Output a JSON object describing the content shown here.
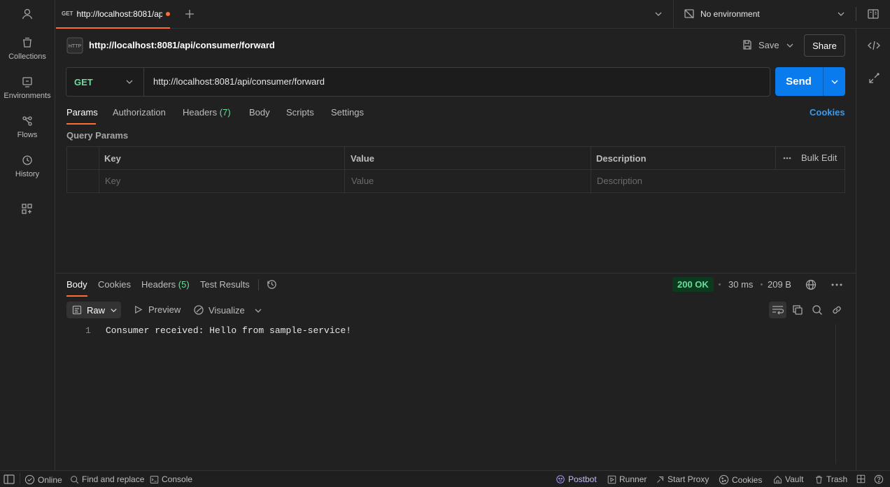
{
  "sidebar": {
    "items": [
      {
        "label": "Collections"
      },
      {
        "label": "Environments"
      },
      {
        "label": "Flows"
      },
      {
        "label": "History"
      }
    ]
  },
  "tab": {
    "method": "GET",
    "title": "http://localhost:8081/ap"
  },
  "environment": {
    "label": "No environment"
  },
  "request": {
    "name": "http://localhost:8081/api/consumer/forward",
    "save_label": "Save",
    "share_label": "Share",
    "method": "GET",
    "url": "http://localhost:8081/api/consumer/forward",
    "send_label": "Send",
    "tabs": [
      {
        "label": "Params"
      },
      {
        "label": "Authorization"
      },
      {
        "label": "Headers",
        "count": "(7)"
      },
      {
        "label": "Body"
      },
      {
        "label": "Scripts"
      },
      {
        "label": "Settings"
      }
    ],
    "cookies_label": "Cookies"
  },
  "query_params": {
    "title": "Query Params",
    "columns": [
      "Key",
      "Value",
      "Description"
    ],
    "bulk_edit": "Bulk Edit",
    "placeholders": [
      "Key",
      "Value",
      "Description"
    ]
  },
  "response": {
    "tabs": [
      {
        "label": "Body"
      },
      {
        "label": "Cookies"
      },
      {
        "label": "Headers",
        "count": "(5)"
      },
      {
        "label": "Test Results"
      }
    ],
    "status": "200 OK",
    "time": "30 ms",
    "size": "209 B",
    "view": {
      "raw": "Raw",
      "preview": "Preview",
      "visualize": "Visualize"
    },
    "line_number": "1",
    "body": "Consumer received: Hello from sample-service!"
  },
  "footer": {
    "online": "Online",
    "find_replace": "Find and replace",
    "console": "Console",
    "postbot": "Postbot",
    "runner": "Runner",
    "start_proxy": "Start Proxy",
    "cookies": "Cookies",
    "vault": "Vault",
    "trash": "Trash"
  },
  "colors": {
    "accent": "#ff6c37",
    "send": "#097bed",
    "method_get": "#6bdd9a",
    "link": "#3d9be9"
  }
}
